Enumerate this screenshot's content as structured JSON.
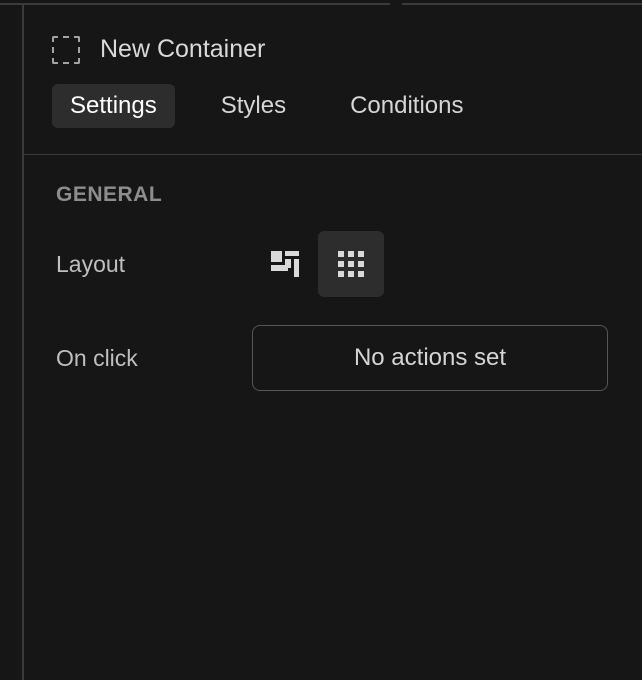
{
  "header": {
    "title": "New Container"
  },
  "tabs": [
    {
      "label": "Settings",
      "active": true
    },
    {
      "label": "Styles",
      "active": false
    },
    {
      "label": "Conditions",
      "active": false
    }
  ],
  "general": {
    "section_title": "GENERAL",
    "layout": {
      "label": "Layout",
      "options": [
        {
          "name": "dashboard",
          "active": false
        },
        {
          "name": "grid",
          "active": true
        }
      ]
    },
    "on_click": {
      "label": "On click",
      "value": "No actions set"
    }
  }
}
